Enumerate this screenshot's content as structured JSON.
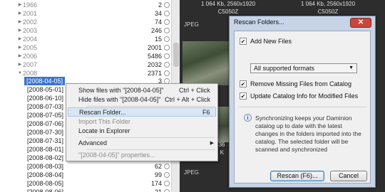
{
  "tree": {
    "rows": [
      {
        "kind": "year",
        "label": "1966",
        "count": "2",
        "arrow": "▶"
      },
      {
        "kind": "year",
        "label": "2001",
        "count": "34",
        "arrow": "▶"
      },
      {
        "kind": "year",
        "label": "2002",
        "count": "74",
        "arrow": "▶"
      },
      {
        "kind": "year",
        "label": "2003",
        "count": "246",
        "arrow": "▶"
      },
      {
        "kind": "year",
        "label": "2004",
        "count": "15",
        "arrow": "▶"
      },
      {
        "kind": "year",
        "label": "2005",
        "count": "2001",
        "arrow": "▶"
      },
      {
        "kind": "year",
        "label": "2006",
        "count": "5486",
        "arrow": "▶"
      },
      {
        "kind": "year",
        "label": "2007",
        "count": "2032",
        "arrow": "▶"
      },
      {
        "kind": "year",
        "label": "2008",
        "count": "2371",
        "arrow": "▼"
      },
      {
        "kind": "sel",
        "label": "[2008-04-05]",
        "count": "3",
        "arrow": ""
      },
      {
        "kind": "date",
        "label": "[2008-05-01]",
        "count": "",
        "arrow": ""
      },
      {
        "kind": "date",
        "label": "[2008-06-10]",
        "count": "",
        "arrow": ""
      },
      {
        "kind": "date",
        "label": "[2008-07-03]",
        "count": "",
        "arrow": ""
      },
      {
        "kind": "date",
        "label": "[2008-07-05]",
        "count": "",
        "arrow": ""
      },
      {
        "kind": "date",
        "label": "[2008-07-06]",
        "count": "",
        "arrow": ""
      },
      {
        "kind": "date",
        "label": "[2008-07-30]",
        "count": "",
        "arrow": ""
      },
      {
        "kind": "date",
        "label": "[2008-07-31]",
        "count": "",
        "arrow": ""
      },
      {
        "kind": "date",
        "label": "[2008-08-01]",
        "count": "",
        "arrow": ""
      },
      {
        "kind": "date",
        "label": "[2008-08-02]",
        "count": "",
        "arrow": ""
      },
      {
        "kind": "date",
        "label": "[2008-08-03]",
        "count": "62",
        "arrow": ""
      },
      {
        "kind": "date",
        "label": "[2008-08-04]",
        "count": "99",
        "arrow": ""
      },
      {
        "kind": "date",
        "label": "[2008-08-05]",
        "count": "174",
        "arrow": ""
      },
      {
        "kind": "date",
        "label": "[2008-08-06]",
        "count": "21",
        "arrow": ""
      }
    ]
  },
  "thumbs": {
    "meta_left_1": "1 064 Kb, 2560x1920",
    "meta_left_2": "C5050Z",
    "meta_right_1": "1 064 Kb, 2560x1920",
    "meta_right_2": "C5050Z",
    "jpeg_label": "JPEG",
    "meta_left_bottom_1": "536",
    "meta_left_bottom_2": "6 K"
  },
  "context_menu": {
    "show_files": "Show files with \"[2008-04-05]\"",
    "show_files_key": "Ctrl + Click",
    "hide_files": "Hide files with \"[2008-04-05]\"",
    "hide_files_key": "Ctrl + Alt + Click",
    "rescan": "Rescan Folder...",
    "rescan_key": "F6",
    "import": "Import This Folder",
    "locate": "Locate in Explorer",
    "advanced": "Advanced",
    "properties": "\"[2008-04-05]\" properties..."
  },
  "dialog": {
    "title": "Rescan Folders...",
    "close": "✕",
    "add_new_files": "Add New Files",
    "add_new_files_checked": true,
    "formats_selected": "All supported formats",
    "remove_missing": "Remove Missing Files from Catalog",
    "remove_missing_checked": true,
    "update_catalog": "Update Catalog Info for Modified Files",
    "update_catalog_checked": true,
    "info_icon": "i",
    "info_text": "Synchronizing keeps your Daminion catalog up to date with the latest changes in the folders imported into the catalog. The selected folder will be scanned and synchronized",
    "rescan_button": "Rescan (F6)...",
    "cancel_button": "Cancel"
  },
  "colors": {
    "selection": "#3b74cf",
    "menu_highlight": "#d8e6f5",
    "dialog_frame": "#c6d4e6",
    "close_button": "#c9463d"
  }
}
